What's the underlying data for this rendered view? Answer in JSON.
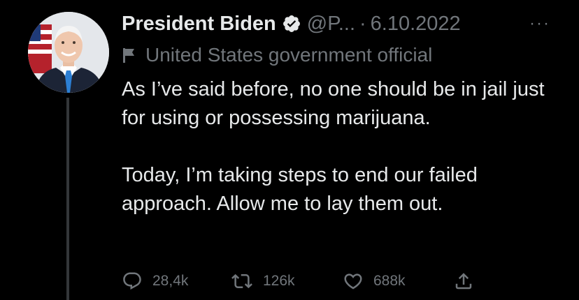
{
  "tweet": {
    "display_name": "President Biden",
    "handle": "@P...",
    "separator": "·",
    "date": "6.10.2022",
    "more_label": "···",
    "account_label": "United States government official",
    "paragraphs": [
      "As I’ve said before, no one should be in jail just for using or possessing marijuana.",
      "Today, I’m taking steps to end our failed approach. Allow me to lay them out."
    ]
  },
  "actions": {
    "reply_count": "28,4k",
    "retweet_count": "126k",
    "like_count": "688k"
  },
  "icons": {
    "verified": "verified-badge-icon",
    "flag": "flag-icon",
    "more": "more-icon",
    "reply": "reply-icon",
    "retweet": "retweet-icon",
    "like": "heart-icon",
    "share": "share-icon"
  },
  "colors": {
    "background": "#000000",
    "primary_text": "#e7e9ea",
    "secondary_text": "#71767b",
    "thread_line": "#333639"
  }
}
